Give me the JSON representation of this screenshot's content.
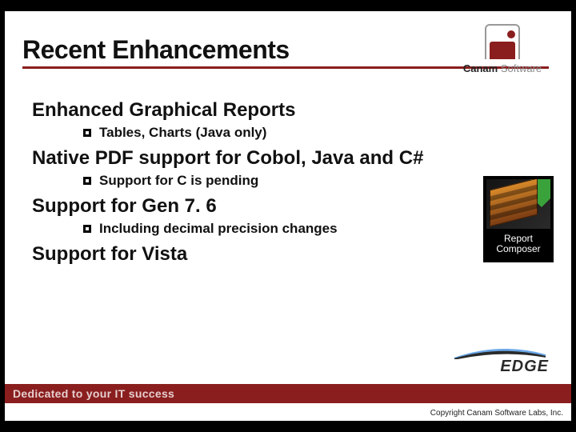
{
  "header": {
    "title": "Recent Enhancements",
    "brand_bold": "Canam",
    "brand_light": " Software"
  },
  "sections": [
    {
      "heading": "Enhanced Graphical Reports",
      "bullets": [
        "Tables, Charts (Java only)"
      ]
    },
    {
      "heading": "Native PDF support for Cobol, Java and C#",
      "bullets": [
        "Support for C is pending"
      ]
    },
    {
      "heading": "Support for Gen 7. 6",
      "bullets": [
        "Including decimal precision changes"
      ]
    },
    {
      "heading": "Support for Vista",
      "bullets": []
    }
  ],
  "side_box": {
    "line1": "Report",
    "line2": "Composer"
  },
  "edge_logo_text": "EDGE",
  "footer": {
    "tagline": "Dedicated to your IT success",
    "copyright": "Copyright Canam Software Labs, Inc."
  }
}
